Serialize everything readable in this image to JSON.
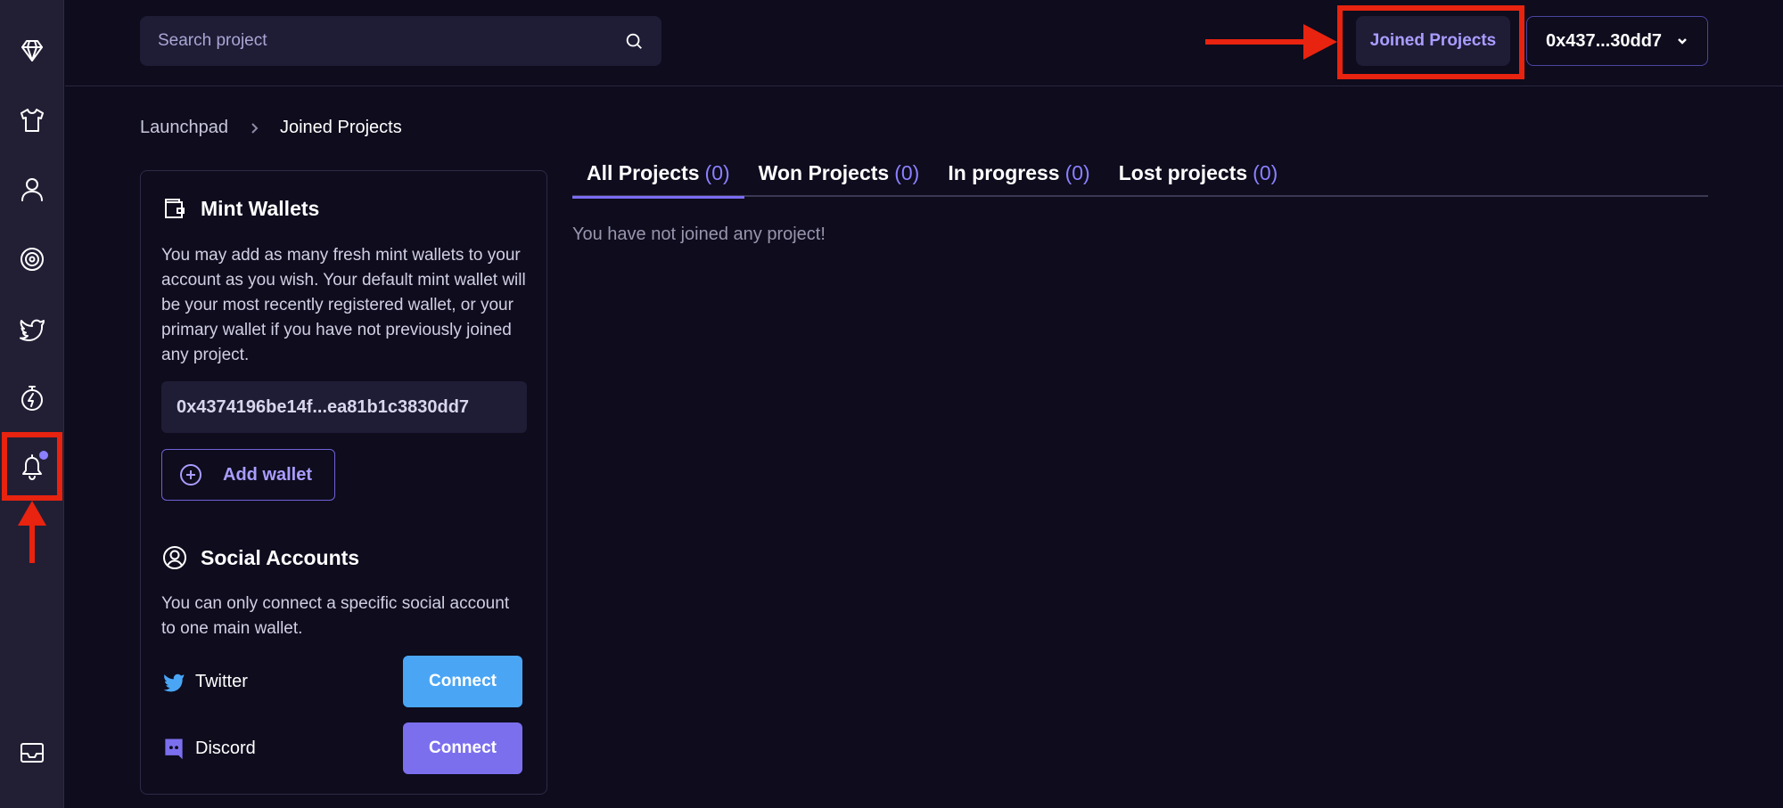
{
  "sidebar": {
    "icons": [
      "diamond-icon",
      "tshirt-icon",
      "user-icon",
      "target-icon",
      "twitter-icon",
      "stopwatch-icon",
      "bell-icon",
      "inbox-icon"
    ],
    "notification_dot_color": "#8b80ff"
  },
  "header": {
    "search_placeholder": "Search project",
    "joined_projects_label": "Joined Projects",
    "wallet_short": "0x437...30dd7"
  },
  "breadcrumb": {
    "parent": "Launchpad",
    "current": "Joined Projects"
  },
  "mint_wallets": {
    "title": "Mint Wallets",
    "description": "You may add as many fresh mint wallets to your account as you wish. Your default mint wallet will be your most recently registered wallet, or your primary wallet if you have not previously joined any project.",
    "address": "0x4374196be14f...ea81b1c3830dd7",
    "add_wallet_label": "Add wallet"
  },
  "social_accounts": {
    "title": "Social Accounts",
    "description": "You can only connect a specific social account to one main wallet.",
    "accounts": [
      {
        "name": "Twitter",
        "button": "Connect",
        "color": "#4aa6f5"
      },
      {
        "name": "Discord",
        "button": "Connect",
        "color": "#7c6fee"
      }
    ]
  },
  "tabs": [
    {
      "label": "All Projects",
      "count": "(0)"
    },
    {
      "label": "Won Projects",
      "count": "(0)"
    },
    {
      "label": "In progress",
      "count": "(0)"
    },
    {
      "label": "Lost projects",
      "count": "(0)"
    }
  ],
  "empty_message": "You have not joined any project!",
  "colors": {
    "accent": "#8b80ff",
    "highlight": "#e8230f",
    "background": "#0e0c1d"
  }
}
